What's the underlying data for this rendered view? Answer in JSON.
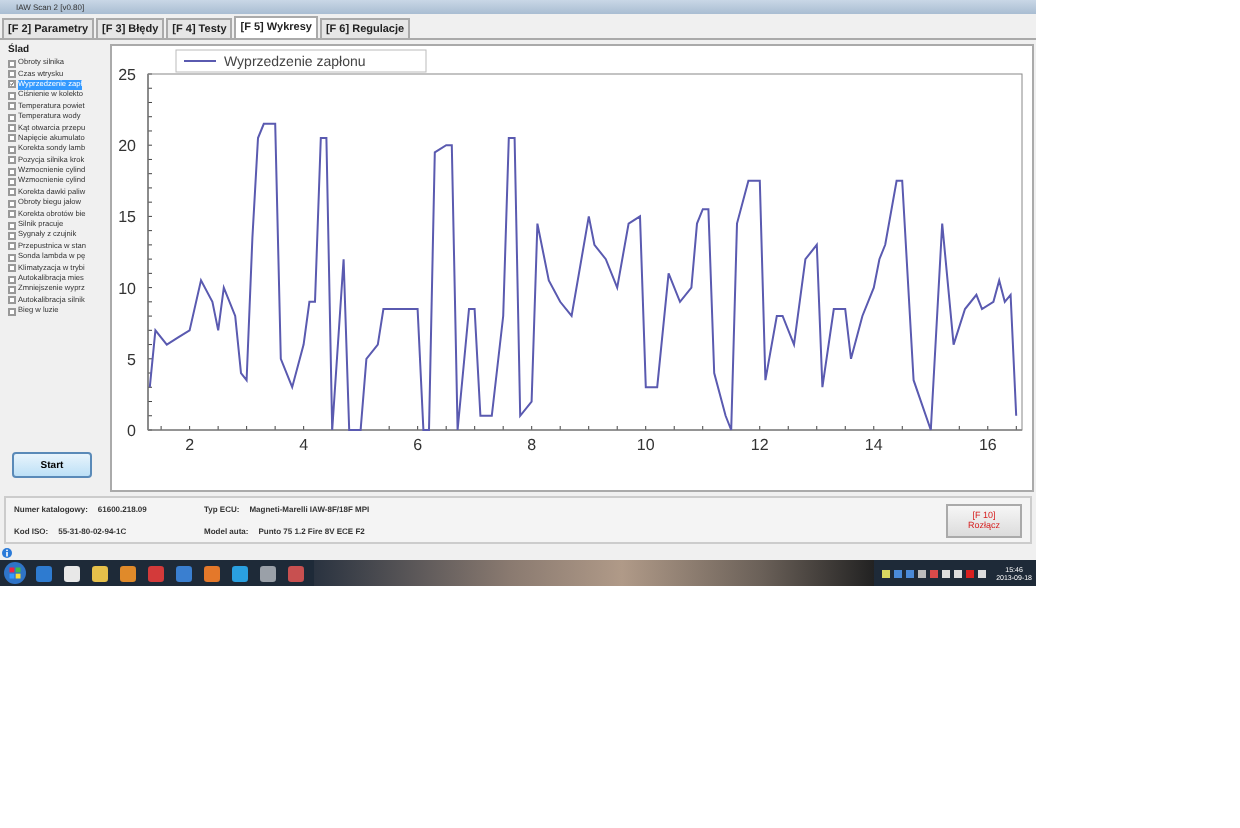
{
  "window": {
    "title": "IAW Scan 2 [v0.80]"
  },
  "tabs": [
    {
      "label": "[F 2] Parametry",
      "selected": false
    },
    {
      "label": "[F 3] Błędy",
      "selected": false
    },
    {
      "label": "[F 4] Testy",
      "selected": false
    },
    {
      "label": "[F 5] Wykresy",
      "selected": true
    },
    {
      "label": "[F 6] Regulacje",
      "selected": false
    }
  ],
  "sidebar": {
    "title": "Ślad",
    "items": [
      {
        "label": "Obroty silnika",
        "checked": false,
        "selected": false
      },
      {
        "label": "Czas wtrysku",
        "checked": false,
        "selected": false
      },
      {
        "label": "Wyprzedzenie zapł",
        "checked": true,
        "selected": true
      },
      {
        "label": "Ciśnienie w kolekto",
        "checked": false,
        "selected": false
      },
      {
        "label": "Temperatura powiet",
        "checked": false,
        "selected": false
      },
      {
        "label": "Temperatura wody",
        "checked": false,
        "selected": false
      },
      {
        "label": "Kąt otwarcia przepu",
        "checked": false,
        "selected": false
      },
      {
        "label": "Napięcie akumulato",
        "checked": false,
        "selected": false
      },
      {
        "label": "Korekta sondy lamb",
        "checked": false,
        "selected": false
      },
      {
        "label": "Pozycja silnika krok",
        "checked": false,
        "selected": false
      },
      {
        "label": "Wzmocnienie cylind",
        "checked": false,
        "selected": false
      },
      {
        "label": "Wzmocnienie cylind",
        "checked": false,
        "selected": false
      },
      {
        "label": "Korekta dawki paliw",
        "checked": false,
        "selected": false
      },
      {
        "label": "Obroty biegu jałow",
        "checked": false,
        "selected": false
      },
      {
        "label": "Korekta obrotów bie",
        "checked": false,
        "selected": false
      },
      {
        "label": "Silnik pracuje",
        "checked": false,
        "selected": false
      },
      {
        "label": "Sygnały z czujnik",
        "checked": false,
        "selected": false
      },
      {
        "label": "Przepustnica w stan",
        "checked": false,
        "selected": false
      },
      {
        "label": "Sonda lambda w pę",
        "checked": false,
        "selected": false
      },
      {
        "label": "Klimatyzacja w trybi",
        "checked": false,
        "selected": false
      },
      {
        "label": "Autokalibracja mies",
        "checked": false,
        "selected": false
      },
      {
        "label": "Zmniejszenie wyprz",
        "checked": false,
        "selected": false
      },
      {
        "label": "Autokalibracja silnik",
        "checked": false,
        "selected": false
      },
      {
        "label": "Bieg w luzie",
        "checked": false,
        "selected": false
      }
    ],
    "start_button": "Start"
  },
  "chart": {
    "chart_data": {
      "type": "line",
      "xlim": [
        1.27,
        16.6
      ],
      "ylim": [
        0,
        25
      ],
      "xticks": [
        2,
        4,
        6,
        8,
        10,
        12,
        14,
        16
      ],
      "yticks": [
        0,
        5,
        10,
        15,
        20,
        25
      ],
      "x": [
        1.3,
        1.4,
        1.6,
        1.8,
        2.0,
        2.2,
        2.4,
        2.5,
        2.6,
        2.8,
        2.9,
        3.0,
        3.1,
        3.2,
        3.3,
        3.5,
        3.6,
        3.8,
        4.0,
        4.1,
        4.2,
        4.3,
        4.4,
        4.5,
        4.7,
        4.8,
        5.0,
        5.1,
        5.3,
        5.4,
        5.6,
        6.0,
        6.1,
        6.2,
        6.3,
        6.5,
        6.6,
        6.7,
        6.9,
        7.0,
        7.1,
        7.3,
        7.5,
        7.6,
        7.7,
        7.8,
        8.0,
        8.1,
        8.3,
        8.5,
        8.7,
        9.0,
        9.1,
        9.3,
        9.5,
        9.7,
        9.9,
        10.0,
        10.2,
        10.4,
        10.6,
        10.8,
        10.9,
        11.0,
        11.1,
        11.2,
        11.4,
        11.5,
        11.6,
        11.8,
        12.0,
        12.1,
        12.3,
        12.4,
        12.6,
        12.8,
        13.0,
        13.1,
        13.3,
        13.5,
        13.6,
        13.8,
        14.0,
        14.1,
        14.2,
        14.4,
        14.5,
        14.7,
        15.0,
        15.2,
        15.4,
        15.6,
        15.8,
        15.9,
        16.1,
        16.2,
        16.3,
        16.4,
        16.5
      ],
      "series": [
        {
          "name": "Wyprzedzenie zapłonu",
          "color": "#5a5ab0",
          "values": [
            3,
            7,
            6,
            6.5,
            7,
            10.5,
            9,
            7,
            10,
            8,
            4,
            3.5,
            13.5,
            20.5,
            21.5,
            21.5,
            5,
            3,
            6,
            9,
            9,
            20.5,
            20.5,
            0,
            12,
            0,
            0,
            5,
            6,
            8.5,
            8.5,
            8.5,
            0,
            0,
            19.5,
            20,
            20,
            0,
            8.5,
            8.5,
            1,
            1,
            8,
            20.5,
            20.5,
            1,
            2,
            14.5,
            10.5,
            9,
            8,
            15,
            13,
            12,
            10,
            14.5,
            15,
            3,
            3,
            11,
            9,
            10,
            14.5,
            15.5,
            15.5,
            4,
            1,
            0,
            14.5,
            17.5,
            17.5,
            3.5,
            8,
            8,
            6,
            12,
            13,
            3,
            8.5,
            8.5,
            5,
            8,
            10,
            12,
            13,
            17.5,
            17.5,
            3.5,
            0,
            14.5,
            6,
            8.5,
            9.5,
            8.5,
            9,
            10.5,
            9,
            9.5,
            1
          ]
        }
      ]
    }
  },
  "info": [
    {
      "label": "Numer katalogowy:",
      "value": "61600.218.09"
    },
    {
      "label": "Typ ECU:",
      "value": "Magneti-Marelli IAW-8F/18F MPI"
    },
    {
      "label": "Kod ISO:",
      "value": "55-31-80-02-94-1C"
    },
    {
      "label": "Model auta:",
      "value": "Punto 75 1.2 Fire 8V ECE F2"
    }
  ],
  "disconnect_button": {
    "key": "[F 10]",
    "label": "Rozłącz"
  },
  "taskbar": {
    "time": "15:46",
    "date": "2013-09-18"
  }
}
